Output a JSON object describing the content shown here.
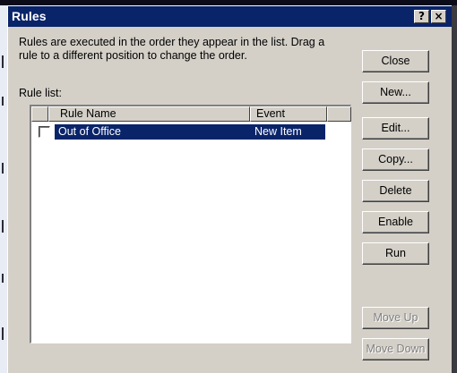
{
  "window": {
    "title": "Rules",
    "help_label": "?",
    "close_label": "×"
  },
  "description": "Rules are executed in the order they appear in the list.  Drag a\nrule to a different position to change the order.",
  "rule_list": {
    "label": "Rule list:",
    "columns": [
      "Rule Name",
      "Event"
    ],
    "rows": [
      {
        "name": "Out of Office",
        "event": "New Item",
        "checked": false,
        "selected": true
      }
    ]
  },
  "buttons": {
    "close": "Close",
    "new": "New...",
    "edit": "Edit...",
    "copy": "Copy...",
    "delete": "Delete",
    "enable": "Enable",
    "run": "Run",
    "move_up": "Move Up",
    "move_down": "Move Down"
  },
  "colors": {
    "title_bar": "#0a246a",
    "dialog_face": "#d4d0c8",
    "selection": "#0a246a"
  }
}
